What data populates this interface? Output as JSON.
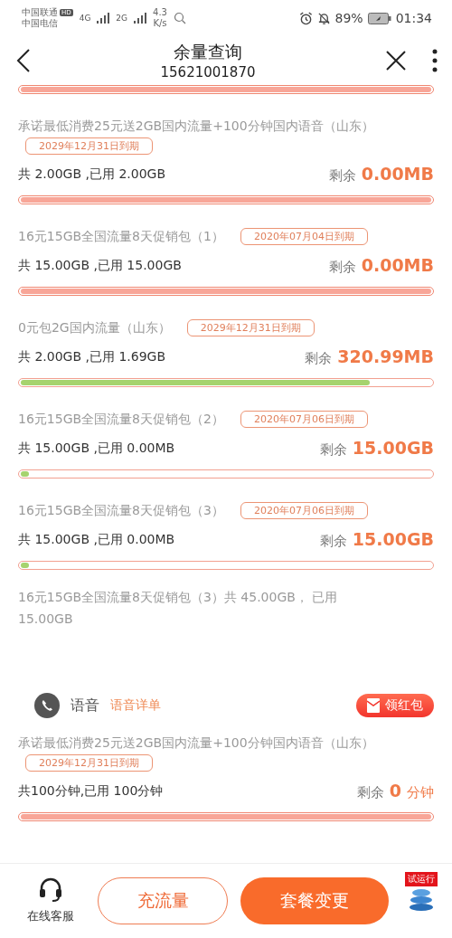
{
  "status_bar": {
    "carrier_1": "中国联通",
    "hd": "HD",
    "carrier_2": "中国电信",
    "signal_1": "4G",
    "signal_2": "2G",
    "speed": "4.3",
    "speed_unit": "K/s",
    "battery": "89%",
    "time": "01:34"
  },
  "header": {
    "title": "余量查询",
    "subtitle": "15621001870"
  },
  "top_bar": {
    "level": 1
  },
  "data_items": [
    {
      "title": "承诺最低消费25元送2GB国内流量+100分钟国内语音（山东）",
      "expiry": "2029年12月31日到期",
      "total": "共 2.00GB ,已用 2.00GB",
      "remaining_label": "剩余",
      "remaining": "0.00MB",
      "level": 1
    },
    {
      "title": "16元15GB全国流量8天促销包（1）",
      "expiry": "2020年07月04日到期",
      "total": "共 15.00GB ,已用 15.00GB",
      "remaining_label": "剩余",
      "remaining": "0.00MB",
      "level": 1
    },
    {
      "title": "0元包2G国内流量（山东）",
      "expiry": "2029年12月31日到期",
      "total": "共 2.00GB ,已用 1.69GB",
      "remaining_label": "剩余",
      "remaining": "320.99MB",
      "level": 0.85
    },
    {
      "title": "16元15GB全国流量8天促销包（2）",
      "expiry": "2020年07月06日到期",
      "total": "共 15.00GB ,已用 0.00MB",
      "remaining_label": "剩余",
      "remaining": "15.00GB",
      "level": 0.02
    },
    {
      "title": "16元15GB全国流量8天促销包（3）",
      "expiry": "2020年07月06日到期",
      "total": "共 15.00GB ,已用 0.00MB",
      "remaining_label": "剩余",
      "remaining": "15.00GB",
      "level": 0.02
    }
  ],
  "summary": "16元15GB全国流量8天促销包（3）共 45.00GB， 已用 15.00GB",
  "voice": {
    "label": "语音",
    "detail_link": "语音详单",
    "red_packet_button": "领红包",
    "item": {
      "title": "承诺最低消费25元送2GB国内流量+100分钟国内语音（山东）",
      "expiry": "2029年12月31日到期",
      "total": "共100分钟,已用 100分钟",
      "remaining_label": "剩余",
      "remaining": "0",
      "unit": "分钟",
      "level": 1
    }
  },
  "bottom_bar": {
    "service": "在线客服",
    "recharge_button": "充流量",
    "change_plan_button": "套餐变更",
    "trial_badge": "试运行"
  }
}
